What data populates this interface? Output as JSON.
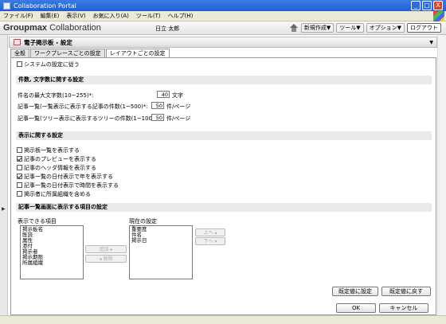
{
  "window": {
    "title": "Collaboration Portal",
    "min": "_",
    "max": "□",
    "close": "X"
  },
  "menu": [
    "ファイル(F)",
    "編集(E)",
    "表示(V)",
    "お気に入り(A)",
    "ツール(T)",
    "ヘルプ(H)"
  ],
  "header": {
    "brand_bold": "Groupmax",
    "brand_rest": " Collaboration",
    "user": "日立 太郎",
    "new": "新規作成▼",
    "tool": "ツール▼",
    "option": "オプション▼",
    "logout": "ログアウト"
  },
  "panel": {
    "title": "電子掲示板 - 設定",
    "menu": "▼"
  },
  "tabs": [
    "全般",
    "ワークプレースごとの設定",
    "レイアウトごとの設定"
  ],
  "system_checkbox": "システムの設定に従う",
  "counts": {
    "title": "件数, 文字数に関する設定",
    "rows": [
      {
        "label": "件名の最大文字数(10~255)*:",
        "value": "40",
        "unit": "文字"
      },
      {
        "label": "記事一覧(一覧表示に表示する記事の件数(1~500)*:",
        "value": "50",
        "unit": "件/ページ"
      },
      {
        "label": "記事一覧(ツリー表示に表示するツリーの件数(1~100)*:",
        "value": "50",
        "unit": "件/ページ"
      }
    ]
  },
  "display": {
    "title": "表示に関する設定",
    "options": [
      {
        "label": "掲示板一覧を表示する",
        "checked": false
      },
      {
        "label": "記事のプレビューを表示する",
        "checked": true
      },
      {
        "label": "記事のヘッダ情報を表示する",
        "checked": false
      },
      {
        "label": "記事一覧の日付表示で年を表示する",
        "checked": true
      },
      {
        "label": "記事一覧の日付表示で時間を表示する",
        "checked": false
      },
      {
        "label": "掲示者に所属組織を含める",
        "checked": false
      }
    ]
  },
  "columns": {
    "title": "記事一覧画面に表示する項目の設定",
    "available_label": "表示できる項目",
    "available": [
      "掲示板名",
      "既読",
      "属性",
      "添付",
      "掲示者",
      "掲示期限",
      "所属組織"
    ],
    "current_label": "現在の設定",
    "current": [
      "重要度",
      "件名",
      "掲示日"
    ],
    "add": "追加 ▸",
    "remove": "◂ 削除",
    "up": "上へ ▴",
    "down": "下へ ▾"
  },
  "buttons": {
    "set_default": "既定値に設定",
    "restore_default": "既定値に戻す",
    "ok": "OK",
    "cancel": "キャンセル"
  }
}
